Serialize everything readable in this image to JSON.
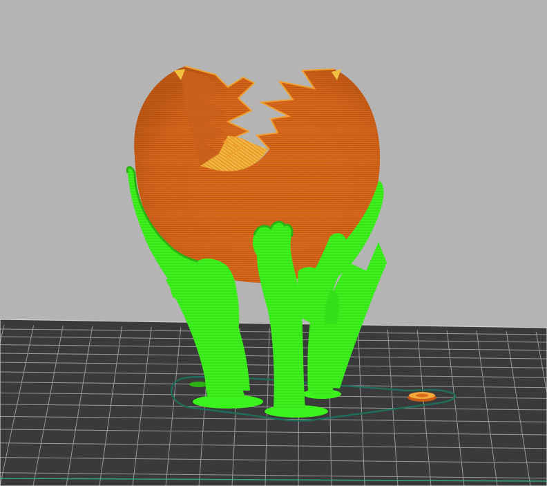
{
  "viewport": {
    "background": "#b4b4b4",
    "bed_color": "#383838",
    "grid_line_color": "#9a9a9a",
    "grid_major_color": "#d0d0d0"
  },
  "model": {
    "object_color": "#d96a1e",
    "infill_color": "#f0b833",
    "support_color": "#3cf21c",
    "support_shade_color": "#2cb014",
    "skirt_color": "#1f6d5a"
  }
}
